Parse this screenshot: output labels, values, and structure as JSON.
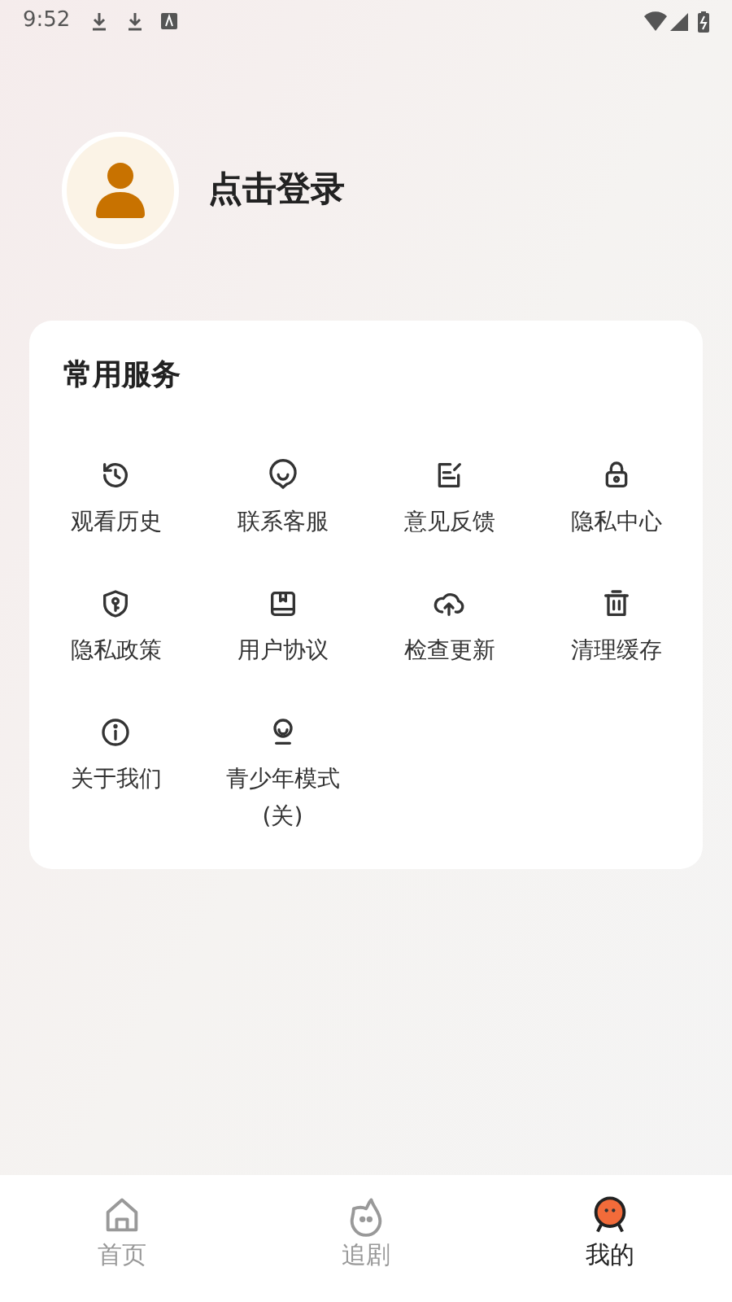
{
  "status_bar": {
    "time": "9:52"
  },
  "profile": {
    "login_label": "点击登录"
  },
  "services": {
    "title": "常用服务",
    "items": [
      {
        "label": "观看历史"
      },
      {
        "label": "联系客服"
      },
      {
        "label": "意见反馈"
      },
      {
        "label": "隐私中心"
      },
      {
        "label": "隐私政策"
      },
      {
        "label": "用户协议"
      },
      {
        "label": "检查更新"
      },
      {
        "label": "清理缓存"
      },
      {
        "label": "关于我们"
      },
      {
        "label": "青少年模式\n(关)"
      }
    ]
  },
  "tab_bar": [
    {
      "label": "首页",
      "selected": false
    },
    {
      "label": "追剧",
      "selected": false
    },
    {
      "label": "我的",
      "selected": true
    }
  ]
}
